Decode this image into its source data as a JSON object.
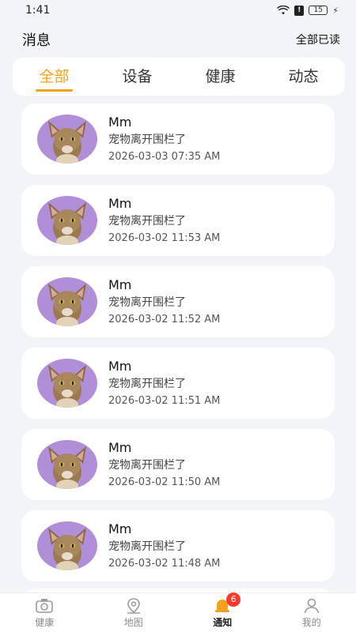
{
  "status": {
    "time": "1:41",
    "battery": "15"
  },
  "header": {
    "title": "消息",
    "mark_all_read": "全部已读"
  },
  "tabs": [
    {
      "label": "全部",
      "active": true
    },
    {
      "label": "设备",
      "active": false
    },
    {
      "label": "健康",
      "active": false
    },
    {
      "label": "动态",
      "active": false
    }
  ],
  "notifications": [
    {
      "name": "Mm",
      "message": "宠物离开围栏了",
      "time": "2026-03-03 07:35 AM"
    },
    {
      "name": "Mm",
      "message": "宠物离开围栏了",
      "time": "2026-03-02 11:53 AM"
    },
    {
      "name": "Mm",
      "message": "宠物离开围栏了",
      "time": "2026-03-02 11:52 AM"
    },
    {
      "name": "Mm",
      "message": "宠物离开围栏了",
      "time": "2026-03-02 11:51 AM"
    },
    {
      "name": "Mm",
      "message": "宠物离开围栏了",
      "time": "2026-03-02 11:50 AM"
    },
    {
      "name": "Mm",
      "message": "宠物离开围栏了",
      "time": "2026-03-02 11:48 AM"
    }
  ],
  "bottom_nav": [
    {
      "label": "健康",
      "icon": "camera-icon",
      "active": false
    },
    {
      "label": "地图",
      "icon": "map-pin-icon",
      "active": false
    },
    {
      "label": "通知",
      "icon": "bell-icon",
      "active": true,
      "badge": "6"
    },
    {
      "label": "我的",
      "icon": "user-icon",
      "active": false
    }
  ],
  "colors": {
    "accent": "#f2a21c",
    "badge": "#ff3b2f",
    "avatar_bg": "#b08fd8"
  }
}
